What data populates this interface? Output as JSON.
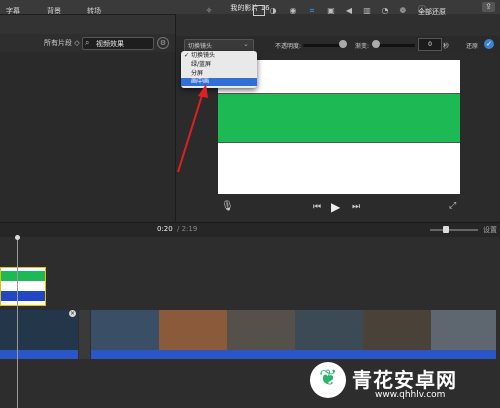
{
  "window": {
    "title": "我的影片 16",
    "share_icon": "share-icon"
  },
  "browser": {
    "tabs": [
      "字幕",
      "背景",
      "转场"
    ],
    "filter": "所有片段 ◇",
    "search_value": "视频效果"
  },
  "toolbar": {
    "icons": [
      "magic-wand-icon",
      "overlay-icon",
      "color-balance-icon",
      "color-correction-icon",
      "crop-icon",
      "stabilization-icon",
      "volume-icon",
      "noise-reduction-icon",
      "speed-icon",
      "clip-filter-icon",
      "info-icon"
    ],
    "reset_all": "全部还原"
  },
  "overlay_settings": {
    "style_selected": "切换镜头",
    "opacity_label": "不透明度:",
    "fade_label": "渐变:",
    "fade_value": "0",
    "fade_unit": "秒",
    "apply_label": "还原",
    "options": [
      {
        "label": "切换镜头",
        "checked": true,
        "highlighted": false
      },
      {
        "label": "绿/蓝屏",
        "checked": false,
        "highlighted": false
      },
      {
        "label": "分屏",
        "checked": false,
        "highlighted": false
      },
      {
        "label": "画中画",
        "checked": false,
        "highlighted": true
      }
    ]
  },
  "playback": {
    "current_time": "0:20",
    "total_time": "/ 2:19"
  },
  "timeline": {
    "settings_label": "设置"
  },
  "watermark": {
    "brand": "青花安卓网",
    "url": "www.qhhlv.com"
  },
  "colors": {
    "accent_blue": "#2f6fd6",
    "green": "#1db954",
    "audio_blue": "#2a56c7",
    "arrow_red": "#e02020",
    "selection_yellow": "#e3c300"
  }
}
